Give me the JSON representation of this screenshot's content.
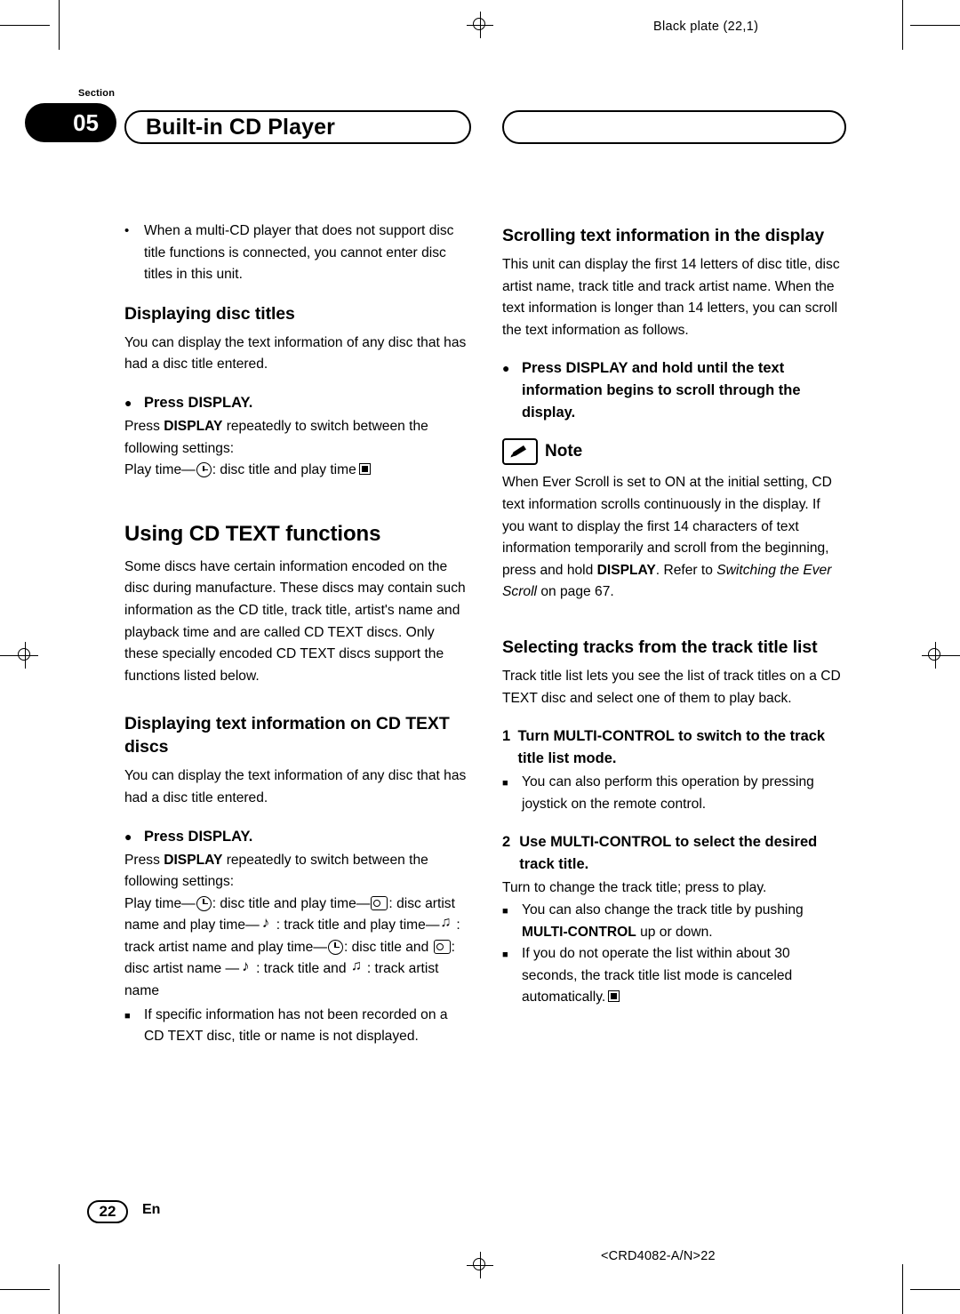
{
  "header": {
    "black_plate": "Black plate (22,1)",
    "section_label": "Section",
    "section_number": "05",
    "chapter_title": "Built-in CD Player"
  },
  "left_column": {
    "intro_bullet": "When a multi-CD player that does not support disc title functions is connected, you cannot enter disc titles in this unit.",
    "heading_displaying_disc_titles": "Displaying disc titles",
    "displaying_disc_titles_body": "You can display the text information of any disc that has had a disc title entered.",
    "press_display_1": "Press DISPLAY.",
    "press_display_1_body_a": "Press ",
    "press_display_1_body_bold": "DISPLAY",
    "press_display_1_body_b": " repeatedly to switch between the following settings:",
    "play_time_line_a": "Play time—",
    "play_time_line_b": ": disc title and play time",
    "heading_using_cd_text": "Using CD TEXT functions",
    "using_cd_text_body": "Some discs have certain information encoded on the disc during manufacture. These discs may contain such information as the CD title, track title, artist's name and playback time and are called CD TEXT discs. Only these specially encoded CD TEXT discs support the functions listed below.",
    "heading_displaying_text_info": "Displaying text information on CD TEXT discs",
    "displaying_text_info_body": "You can display the text information of any disc that has had a disc title entered.",
    "press_display_2": "Press DISPLAY.",
    "press_display_2_body_a": "Press ",
    "press_display_2_body_bold": "DISPLAY",
    "press_display_2_body_b": " repeatedly to switch between the following settings:",
    "seq_1": "Play time—",
    "seq_2": ": disc title and play time—",
    "seq_3": ": disc artist name and play time—",
    "seq_4": ": track title and play time—",
    "seq_5": ": track artist name and play time—",
    "seq_6": ": disc title and ",
    "seq_7": ": disc artist name —",
    "seq_8": ": track title and ",
    "seq_9": ": track artist name",
    "note_square": "If specific information has not been recorded on a CD TEXT disc, title or name is not displayed."
  },
  "right_column": {
    "heading_scrolling": "Scrolling text information in the display",
    "scrolling_body": "This unit can display the first 14 letters of disc title, disc artist name, track title and track artist name. When the text information is longer than 14 letters, you can scroll the text information as follows.",
    "press_display_hold": "Press DISPLAY and hold until the text information begins to scroll through the display.",
    "note_label": "Note",
    "note_icon": "pencil-icon",
    "note_body_a": "When Ever Scroll is set to ON at the initial setting, CD text information scrolls continuously in the display. If you want to display the first 14 characters of text information temporarily and scroll from the beginning, press and hold ",
    "note_body_bold": "DISPLAY",
    "note_body_b": ". Refer to ",
    "note_body_italic": "Switching the Ever Scroll",
    "note_body_c": " on page 67.",
    "heading_selecting_tracks": "Selecting tracks from the track title list",
    "selecting_tracks_body": "Track title list lets you see the list of track titles on a CD TEXT disc and select one of them to play back.",
    "step1_num": "1",
    "step1_text": "Turn MULTI-CONTROL to switch to the track title list mode.",
    "step1_sq": "You can also perform this operation by pressing joystick on the remote control.",
    "step2_num": "2",
    "step2_text": "Use MULTI-CONTROL to select the desired track title.",
    "step2_body": "Turn to change the track title; press to play.",
    "step2_sq_a": "You can also change the track title by pushing ",
    "step2_sq_bold": "MULTI-CONTROL",
    "step2_sq_b": " up or down.",
    "step3_sq": "If you do not operate the list within about 30 seconds, the track title list mode is canceled automatically."
  },
  "footer": {
    "page_number": "22",
    "language": "En",
    "part_number": "<CRD4082-A/N>22"
  }
}
